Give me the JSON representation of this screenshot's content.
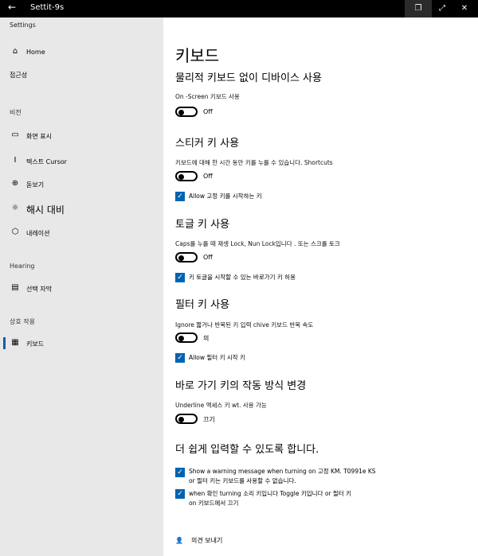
{
  "window": {
    "title": "Settit-9s",
    "back_icon": "←",
    "restore_icon": "❐",
    "maximize_icon": "⤢",
    "close_icon": "✕"
  },
  "sidebar": {
    "app_title": "Settings",
    "home": {
      "icon": "⌂",
      "label": "Home"
    },
    "search_label": "접근성",
    "group_vision": "비전",
    "vision_items": [
      {
        "icon": "▭",
        "label": "화면 표시"
      },
      {
        "icon": "I",
        "label": "텍스트 Cursor"
      },
      {
        "icon": "⊕",
        "label": "돋보기"
      },
      {
        "icon": "☼",
        "label": "해시 대비"
      },
      {
        "icon": "⬡",
        "label": "내레이션"
      }
    ],
    "group_hearing": "Hearing",
    "hearing_items": [
      {
        "icon": "▤",
        "label": "선택 자막"
      }
    ],
    "group_interaction": "상호 작용",
    "interaction_items": [
      {
        "icon": "▦",
        "label": "키보드"
      }
    ]
  },
  "main": {
    "page_title": "키보드",
    "sections": {
      "onscreen": {
        "heading": "물리적 키보드 없이 디바이스 사용",
        "desc": "On -Screen 키보드 사용",
        "toggle_state": "Off"
      },
      "sticky": {
        "heading": "스티커 키 사용",
        "desc": "키보드에 대해 한 시간 동안 키를 누를 수 있습니다. Shortcuts",
        "toggle_state": "Off",
        "checkbox_label": "Allow 고정 키를 시작하는 키"
      },
      "toggle_keys": {
        "heading": "토글 키 사용",
        "desc": "Caps를 누를 때 재생                                  Lock, Nun Lock입니다 . 또는 스크롤 토크",
        "toggle_state": "Off",
        "checkbox_label": "키 토글을 시작할 수 있는 바로가기 키 허용"
      },
      "filter_keys": {
        "heading": "필터 키 사용",
        "desc": "Ignore 짧거나 반복된 키 입력 chive 키보드 반복 속도",
        "toggle_state": "의",
        "checkbox_label": "Allow 필터 키 시작 키"
      },
      "shortcut_behavior": {
        "heading": "바로 가기 키의 작동 방식 변경",
        "desc": "Underline 액세스 키 wt. 사용 가능",
        "toggle_state": "끄기"
      },
      "typing": {
        "heading": "더 쉽게 입력할 수 있도록 합니다.",
        "checkbox1_line1": "Show a warning message when turning on 고정 KM. T0991e KS",
        "checkbox1_line2": "or 필터 키는 키보드를 사용할 수 없습니다.",
        "checkbox2_line1": "when 확인              turning 소리 키입니다 Toggle 키입니다 or 필터 키",
        "checkbox2_line2": "on 키보드에서 끄기"
      }
    },
    "feedback_icon": "👤",
    "feedback_label": "의견 보내기"
  }
}
